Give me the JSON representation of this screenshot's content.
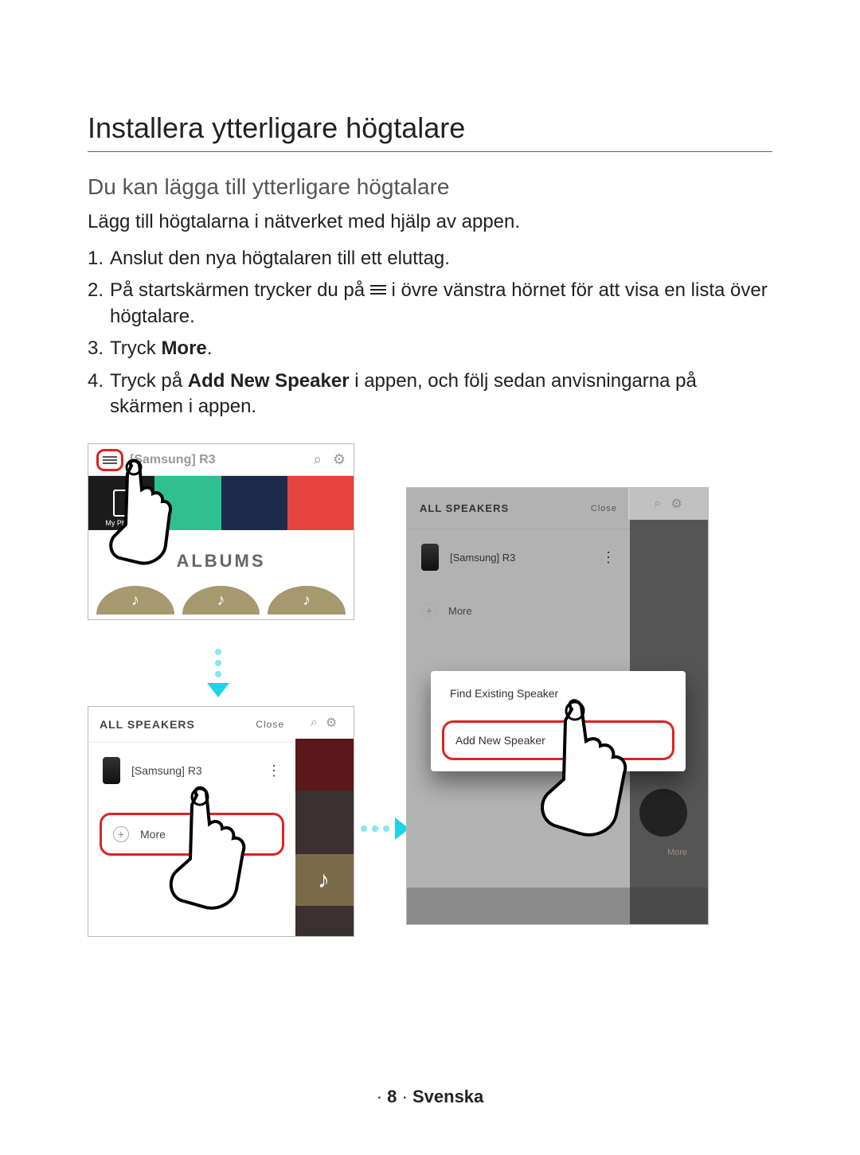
{
  "headings": {
    "h1": "Installera ytterligare högtalare",
    "h2": "Du kan lägga till ytterligare högtalare"
  },
  "intro": "Lägg till högtalarna i nätverket med hjälp av appen.",
  "steps": {
    "s1": "Anslut den nya högtalaren till ett eluttag.",
    "s2a": "På startskärmen trycker du på ",
    "s2b": " i övre vänstra hörnet för att visa en lista över högtalare.",
    "s3a": "Tryck ",
    "s3b": "More",
    "s3c": ".",
    "s4a": "Tryck på ",
    "s4b": "Add New Speaker",
    "s4c": " i appen, och följ sedan anvisningarna på skärmen i appen."
  },
  "shot1": {
    "title": "[Samsung] R3",
    "myphone": "My Phone",
    "albums": "ALBUMS",
    "note": "♪"
  },
  "shot2": {
    "header": "ALL SPEAKERS",
    "close": "Close",
    "speaker": "[Samsung] R3",
    "more": "More",
    "note": "♪"
  },
  "shot3": {
    "header": "ALL SPEAKERS",
    "close": "Close",
    "speaker": "[Samsung] R3",
    "more": "More",
    "opt1": "Find Existing Speaker",
    "opt2": "Add New Speaker",
    "bottom_more": "More"
  },
  "footer": {
    "page": "8",
    "lang": "Svenska"
  }
}
